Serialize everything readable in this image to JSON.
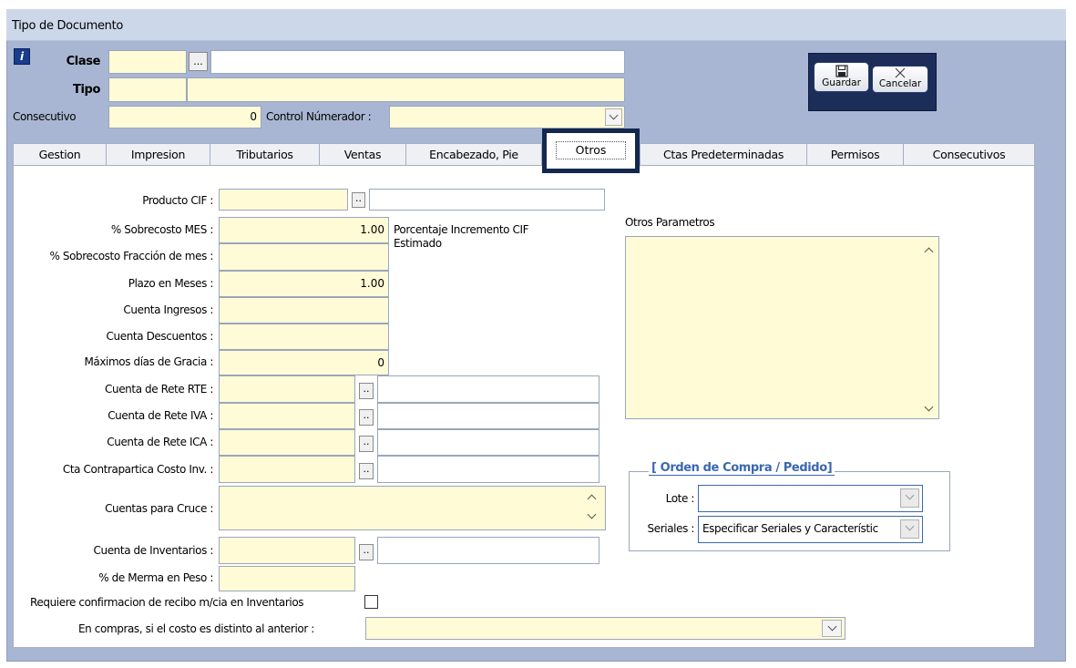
{
  "window": {
    "title": "Tipo de Documento"
  },
  "header": {
    "clase_label": "Clase",
    "tipo_label": "Tipo",
    "consecutivo_label": "Consecutivo",
    "consecutivo_value": "0",
    "control_numerador_label": "Control Númerador :",
    "dots": "...",
    "info_icon_glyph": "i"
  },
  "toolbar": {
    "save_label": "Guardar",
    "cancel_label": "Cancelar"
  },
  "tabs": [
    "Gestion",
    "Impresion",
    "Tributarios",
    "Ventas",
    "Encabezado, Pie",
    "Otros",
    "Ctas Predeterminadas",
    "Permisos",
    "Consecutivos"
  ],
  "active_tab": "Otros",
  "form": {
    "producto_cif_label": "Producto CIF :",
    "sobrecosto_mes_label": "% Sobrecosto MES :",
    "sobrecosto_mes_value": "1.00",
    "porcentaje_note": "Porcentaje Incremento CIF Estimado",
    "sobrecosto_fraccion_label": "% Sobrecosto Fracción de mes :",
    "plazo_meses_label": "Plazo en Meses :",
    "plazo_meses_value": "1.00",
    "cuenta_ingresos_label": "Cuenta Ingresos :",
    "cuenta_descuentos_label": "Cuenta Descuentos :",
    "maximos_dias_label": "Máximos días de Gracia :",
    "maximos_dias_value": "0",
    "rete_rte_label": "Cuenta de Rete RTE :",
    "rete_iva_label": "Cuenta de Rete IVA :",
    "rete_ica_label": "Cuenta de Rete ICA :",
    "contrapartida_label": "Cta Contrapartica Costo Inv. :",
    "cuentas_cruce_label": "Cuentas para Cruce :",
    "cuenta_inventarios_label": "Cuenta de Inventarios :",
    "merma_label": "% de Merma en Peso :",
    "requiere_label": "Requiere confirmacion de recibo  m/cia  en Inventarios",
    "compras_label": "En compras, si el costo es distinto al anterior :",
    "small_dots": ".."
  },
  "otros_parametros": {
    "label": "Otros Parametros"
  },
  "orden_compra": {
    "title": "[ Orden de Compra  / Pedido]",
    "lote_label": "Lote :",
    "seriales_label": "Seriales :",
    "seriales_value": "Especificar Seriales y Característic"
  },
  "colors": {
    "field_yellow": "#fffbd6",
    "window_bg": "#a9b6d3",
    "title_bar": "#ccd7ea",
    "accent_dark": "#1c2d5a",
    "group_title": "#3a67b0"
  }
}
